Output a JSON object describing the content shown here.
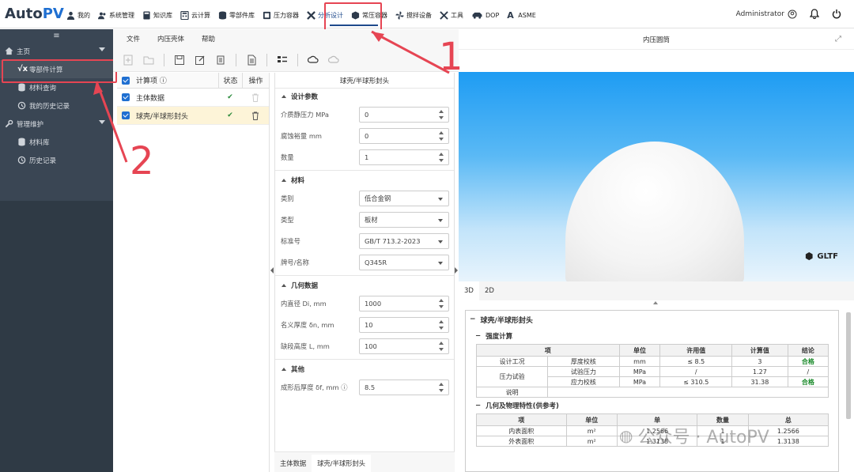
{
  "app": {
    "logo_a": "Auto",
    "logo_b": "PV"
  },
  "nav": [
    {
      "label": "我的",
      "icon": "user-icon"
    },
    {
      "label": "系统管理",
      "icon": "users-icon"
    },
    {
      "label": "知识库",
      "icon": "book-icon"
    },
    {
      "label": "云计算",
      "icon": "calculator-icon"
    },
    {
      "label": "零部件库",
      "icon": "database-icon"
    },
    {
      "label": "压力容器",
      "icon": "gauge-icon"
    },
    {
      "label": "分析设计",
      "icon": "tools-icon"
    },
    {
      "label": "常压容器",
      "icon": "box-icon"
    },
    {
      "label": "搅拌设备",
      "icon": "fan-icon"
    },
    {
      "label": "工具",
      "icon": "wrench-icon"
    },
    {
      "label": "DOP",
      "icon": "car-icon"
    },
    {
      "label": "ASME",
      "icon": "a-icon"
    }
  ],
  "user": {
    "name": "Administrator"
  },
  "sidebar": {
    "items": [
      {
        "label": "主页",
        "level": 0
      },
      {
        "label": "零部件计算",
        "level": 1
      },
      {
        "label": "材料查询",
        "level": 1
      },
      {
        "label": "我的历史记录",
        "level": 1
      },
      {
        "label": "管理维护",
        "level": 0
      },
      {
        "label": "材料库",
        "level": 1
      },
      {
        "label": "历史记录",
        "level": 1
      }
    ]
  },
  "menubar": [
    "文件",
    "内压壳体",
    "帮助"
  ],
  "items_table": {
    "headers": [
      "计算项",
      "状态",
      "操作"
    ],
    "rows": [
      {
        "name": "主体数据",
        "status": "✔"
      },
      {
        "name": "球壳/半球形封头",
        "status": "✔"
      }
    ]
  },
  "form": {
    "title": "球壳/半球形封头",
    "sections": {
      "design": "设计参数",
      "material": "材料",
      "geometry": "几何数据",
      "other": "其他"
    },
    "fields": {
      "pressure": {
        "label": "介质静压力 MPa",
        "value": "0"
      },
      "corrosion": {
        "label": "腐蚀裕量 mm",
        "value": "0"
      },
      "quantity": {
        "label": "数量",
        "value": "1"
      },
      "category": {
        "label": "类别",
        "value": "低合金钢"
      },
      "type": {
        "label": "类型",
        "value": "板材"
      },
      "standard": {
        "label": "标准号",
        "value": "GB/T 713.2-2023"
      },
      "grade": {
        "label": "牌号/名称",
        "value": "Q345R"
      },
      "di": {
        "label": "内直径 Di, mm",
        "value": "1000"
      },
      "dn": {
        "label": "名义厚度 δn, mm",
        "value": "10"
      },
      "l": {
        "label": "缺段高度 L, mm",
        "value": "100"
      },
      "df": {
        "label": "成形后厚度 δf, mm",
        "value": "8.5"
      }
    },
    "bottom_tabs": [
      "主体数据",
      "球壳/半球形封头"
    ]
  },
  "right_panel": {
    "title": "内压圆筒",
    "gltf": "GLTF",
    "tabs": [
      "3D",
      "2D"
    ],
    "result": {
      "title": "球壳/半球形封头",
      "strength_title": "强度计算",
      "strength_headers": [
        "项",
        "单位",
        "许用值",
        "计算值",
        "结论"
      ],
      "strength_rows": [
        {
          "group": "设计工况",
          "item": "厚度校核",
          "unit": "mm",
          "allow": "≤ 8.5",
          "calc": "3",
          "result": "合格"
        },
        {
          "group": "压力试验",
          "item": "试验压力",
          "unit": "MPa",
          "allow": "/",
          "calc": "1.27",
          "result": "/"
        },
        {
          "group": "",
          "item": "应力校核",
          "unit": "MPa",
          "allow": "≤ 310.5",
          "calc": "31.38",
          "result": "合格"
        },
        {
          "group": "说明",
          "item": "",
          "unit": "",
          "allow": "",
          "calc": "",
          "result": ""
        }
      ],
      "geo_title": "几何及物理特性(供参考)",
      "geo_headers": [
        "项",
        "单位",
        "单",
        "数量",
        "总"
      ],
      "geo_rows": [
        {
          "item": "内表面积",
          "unit": "m²",
          "single": "1.2566",
          "qty": "1",
          "total": "1.2566"
        },
        {
          "item": "外表面积",
          "unit": "m²",
          "single": "1.3138",
          "qty": "1",
          "total": "1.3138"
        }
      ]
    }
  },
  "annotations": {
    "one": "1",
    "two": "2"
  },
  "watermark": "公众号 · AutoPV",
  "colors": {
    "accent": "#1f4a8c",
    "highlight": "#e64553",
    "sidebar": "#3a4654",
    "ok": "#1a8a2a"
  }
}
